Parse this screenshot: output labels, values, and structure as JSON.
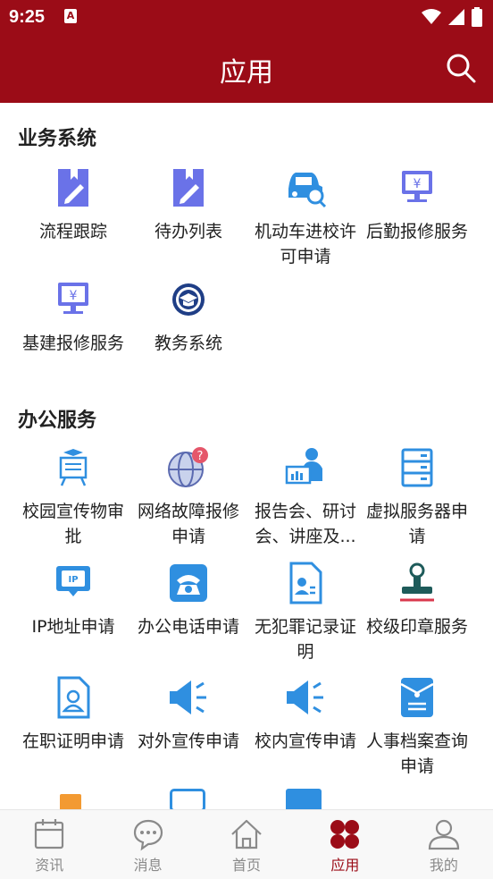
{
  "status_bar": {
    "time": "9:25",
    "notification_glyph": "A"
  },
  "app_bar": {
    "title": "应用"
  },
  "sections": {
    "business": {
      "title": "业务系统",
      "items": [
        {
          "label": "流程跟踪",
          "icon": "pen-document-icon"
        },
        {
          "label": "待办列表",
          "icon": "pen-document-icon"
        },
        {
          "label": "机动车进校许可申请",
          "icon": "car-search-icon"
        },
        {
          "label": "后勤报修服务",
          "icon": "monitor-yen-icon"
        },
        {
          "label": "基建报修服务",
          "icon": "monitor-yen-icon"
        },
        {
          "label": "教务系统",
          "icon": "graduation-seal-icon"
        }
      ]
    },
    "office": {
      "title": "办公服务",
      "items": [
        {
          "label": "校园宣传物审批",
          "icon": "board-presentation-icon"
        },
        {
          "label": "网络故障报修申请",
          "icon": "globe-question-icon"
        },
        {
          "label": "报告会、研讨会、讲座及...",
          "icon": "presenter-icon"
        },
        {
          "label": "虚拟服务器申请",
          "icon": "server-icon"
        },
        {
          "label": "IP地址申请",
          "icon": "ip-monitor-icon"
        },
        {
          "label": "办公电话申请",
          "icon": "telephone-icon"
        },
        {
          "label": "无犯罪记录证明",
          "icon": "id-document-icon"
        },
        {
          "label": "校级印章服务",
          "icon": "stamp-icon"
        },
        {
          "label": "在职证明申请",
          "icon": "person-document-icon"
        },
        {
          "label": "对外宣传申请",
          "icon": "megaphone-icon"
        },
        {
          "label": "校内宣传申请",
          "icon": "megaphone-icon"
        },
        {
          "label": "人事档案查询申请",
          "icon": "archive-envelope-icon"
        }
      ]
    }
  },
  "tab_bar": {
    "tabs": [
      {
        "label": "资讯",
        "icon": "calendar-icon",
        "active": false
      },
      {
        "label": "消息",
        "icon": "chat-bubble-icon",
        "active": false
      },
      {
        "label": "首页",
        "icon": "home-icon",
        "active": false
      },
      {
        "label": "应用",
        "icon": "apps-grid-icon",
        "active": true
      },
      {
        "label": "我的",
        "icon": "person-icon",
        "active": false
      }
    ]
  },
  "colors": {
    "brand": "#9b0c17",
    "icon_blue": "#2f8fe0",
    "icon_purple": "#6a72e8",
    "inactive_tab": "#8a8a8a"
  }
}
